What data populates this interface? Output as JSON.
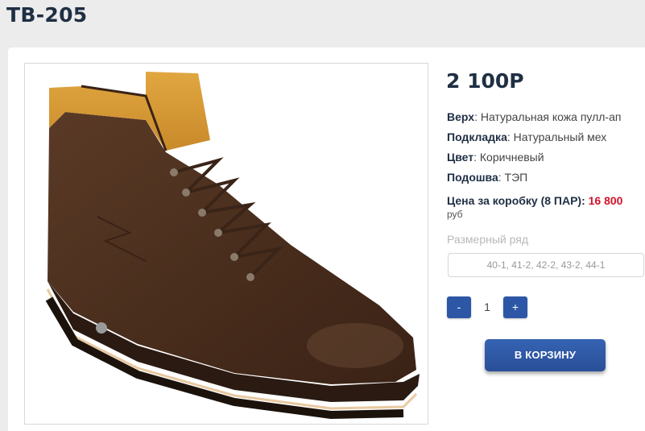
{
  "product": {
    "title": "TB-205",
    "price": "2 100Р",
    "image_alt": "boot-photo"
  },
  "specs": [
    {
      "label": "Верх",
      "value": ": Натуральная кожа пулл-ап"
    },
    {
      "label": "Подкладка",
      "value": ": Натуральный мех"
    },
    {
      "label": "Цвет",
      "value": ": Коричневый"
    },
    {
      "label": "Подошва",
      "value": ": ТЭП"
    }
  ],
  "box_price": {
    "label": "Цена за коробку (8 ПАР):",
    "value": "16 800",
    "unit": "руб"
  },
  "size": {
    "label": "Размерный ряд",
    "selected": "40-1, 41-2, 42-2, 43-2, 44-1"
  },
  "quantity": {
    "minus": "-",
    "value": "1",
    "plus": "+"
  },
  "cart_button": "В КОРЗИНУ",
  "colors": {
    "accent": "#2d57a6",
    "price_red": "#d3132c",
    "heading": "#1f2f44"
  }
}
